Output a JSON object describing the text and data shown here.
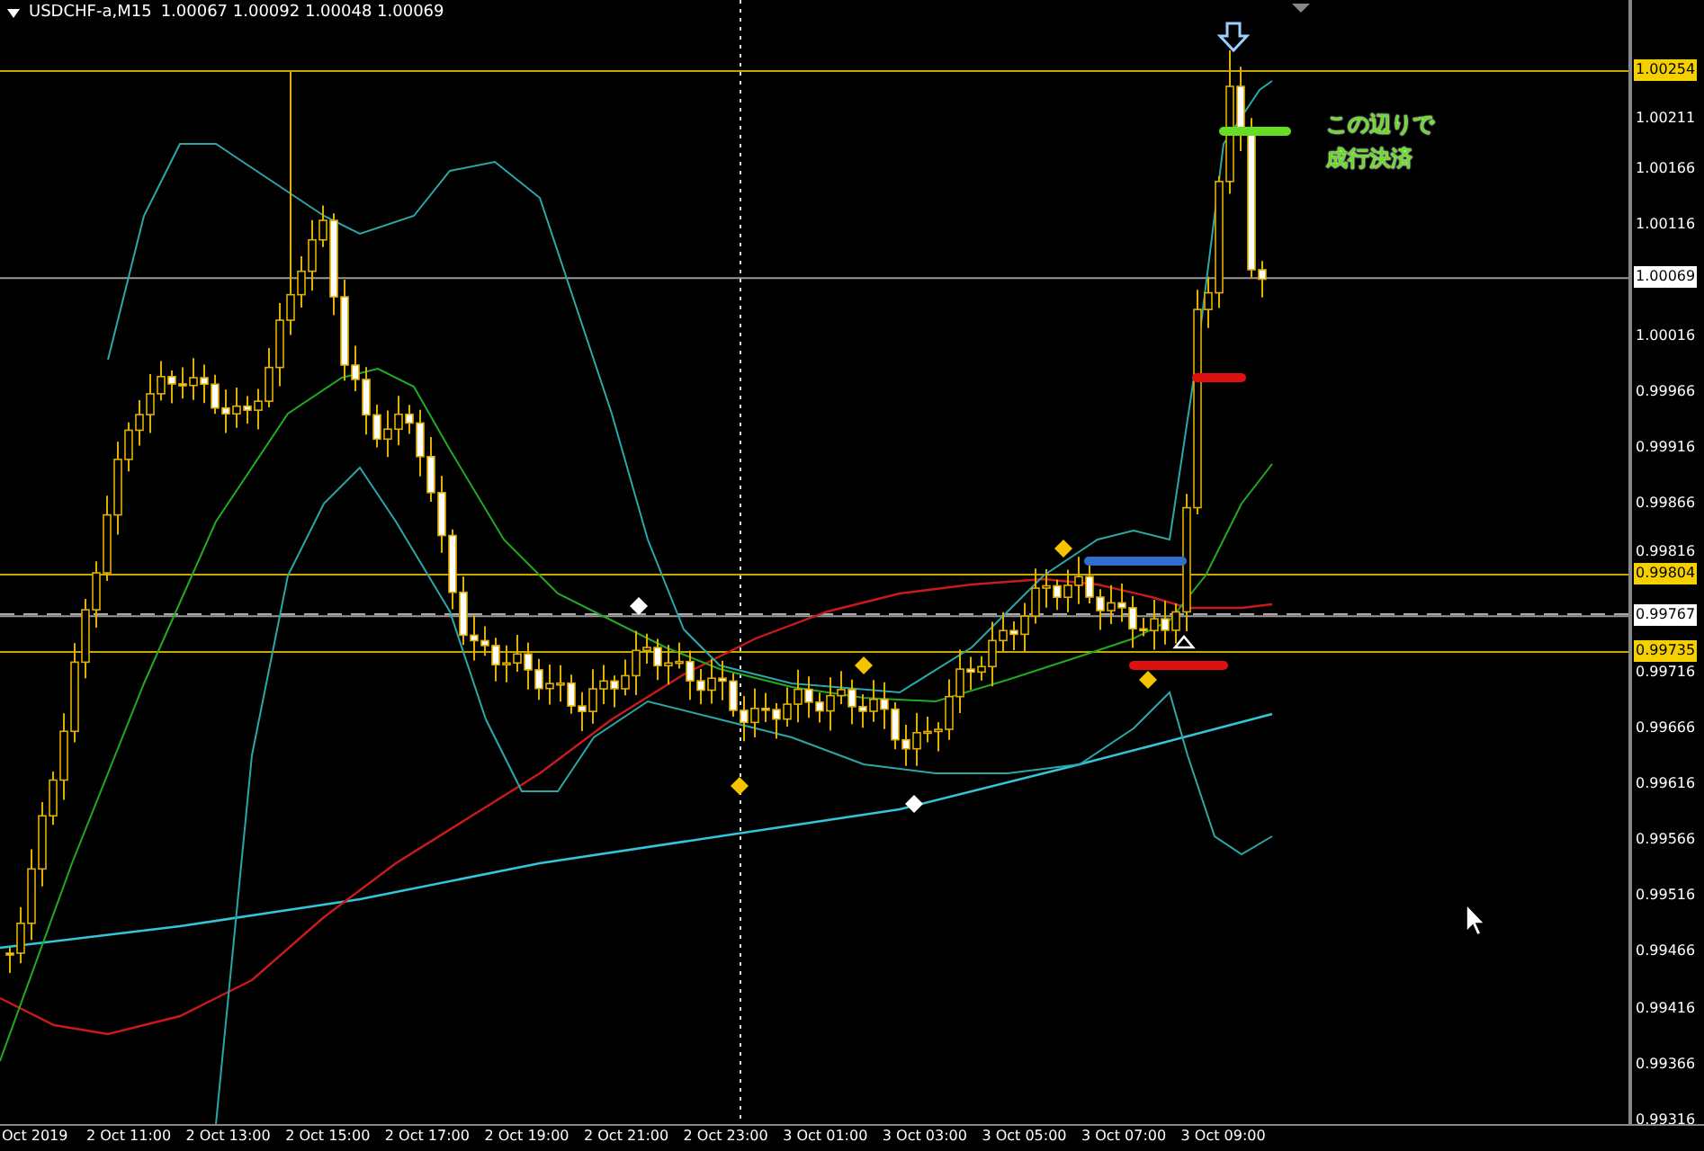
{
  "chart_header": {
    "symbol": "USDCHF-a,M15",
    "ohlc": "1.00067 1.00092 1.00048 1.00069"
  },
  "annotation": {
    "lines": [
      "この辺りで",
      "成行決済"
    ]
  },
  "price_axis": [
    {
      "label": "1.00254",
      "kind": "level"
    },
    {
      "label": "1.00211",
      "kind": "tick"
    },
    {
      "label": "1.00166",
      "kind": "tick"
    },
    {
      "label": "1.00116",
      "kind": "tick"
    },
    {
      "label": "1.00069",
      "kind": "bid"
    },
    {
      "label": "1.00016",
      "kind": "tick"
    },
    {
      "label": "0.99966",
      "kind": "tick"
    },
    {
      "label": "0.99916",
      "kind": "tick"
    },
    {
      "label": "0.99866",
      "kind": "tick"
    },
    {
      "label": "0.99816",
      "kind": "tick"
    },
    {
      "label": "0.99804",
      "kind": "level"
    },
    {
      "label": "0.99767",
      "kind": "bid"
    },
    {
      "label": "0.99735",
      "kind": "level"
    },
    {
      "label": "0.99716",
      "kind": "tick"
    },
    {
      "label": "0.99666",
      "kind": "tick"
    },
    {
      "label": "0.99616",
      "kind": "tick"
    },
    {
      "label": "0.99566",
      "kind": "tick"
    },
    {
      "label": "0.99516",
      "kind": "tick"
    },
    {
      "label": "0.99466",
      "kind": "tick"
    },
    {
      "label": "0.99416",
      "kind": "tick"
    },
    {
      "label": "0.99366",
      "kind": "tick"
    },
    {
      "label": "0.99316",
      "kind": "tick"
    }
  ],
  "time_axis": [
    "Oct 2019",
    "2 Oct 11:00",
    "2 Oct 13:00",
    "2 Oct 15:00",
    "2 Oct 17:00",
    "2 Oct 19:00",
    "2 Oct 21:00",
    "2 Oct 23:00",
    "3 Oct 01:00",
    "3 Oct 03:00",
    "3 Oct 05:00",
    "3 Oct 07:00",
    "3 Oct 09:00"
  ]
}
